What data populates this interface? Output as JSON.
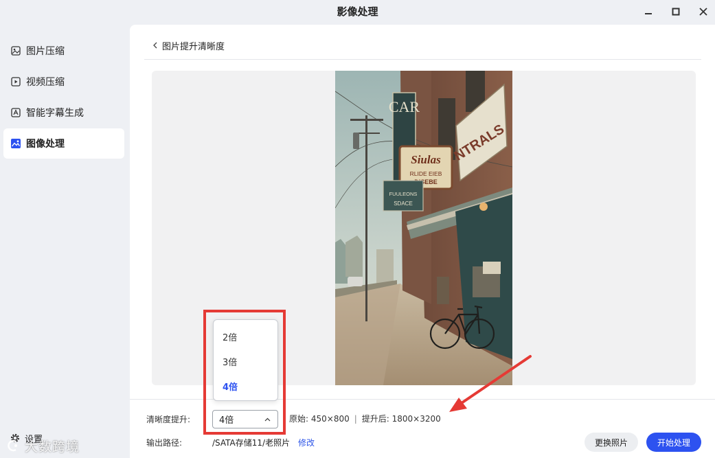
{
  "window": {
    "title": "影像处理"
  },
  "sidebar": {
    "items": [
      {
        "label": "图片压缩",
        "icon": "image-icon"
      },
      {
        "label": "视频压缩",
        "icon": "video-icon"
      },
      {
        "label": "智能字幕生成",
        "icon": "subtitle-icon"
      },
      {
        "label": "图像处理",
        "icon": "image-processing-icon",
        "active": true
      }
    ],
    "settings_label": "设置"
  },
  "watermark": {
    "text": "大数跨境"
  },
  "main": {
    "breadcrumb": "图片提升清晰度",
    "controls": {
      "clarity_label": "清晰度提升:",
      "clarity_value": "4倍",
      "original_info": "原始: 450×800",
      "separator": "|",
      "upscaled_info": "提升后: 1800×3200",
      "output_label": "输出路径:",
      "output_path": "/SATA存储11/老照片",
      "modify_label": "修改"
    },
    "buttons": {
      "replace_photo": "更换照片",
      "start": "开始处理"
    },
    "dropdown": {
      "options": [
        "2倍",
        "3倍",
        "4倍"
      ],
      "selected": "4倍"
    },
    "photo": {
      "sign_vertical": "CAR",
      "sign_main": "Siulas",
      "sign_main_sub1": "RLIDE EIEB",
      "sign_main_sub2": "DISEBE",
      "sign_small1": "FUULEONS",
      "sign_small2": "SDACE",
      "sign_right": "NTRALS"
    }
  },
  "colors": {
    "accent": "#2d52f0",
    "highlight": "#e53a35",
    "sidebar_bg": "#eef0f4"
  }
}
